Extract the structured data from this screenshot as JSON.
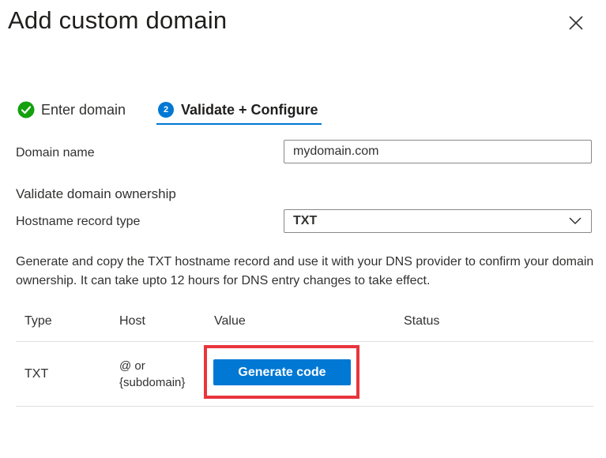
{
  "dialog": {
    "title": "Add custom domain",
    "close_icon": "close-icon"
  },
  "steps": [
    {
      "label": "Enter domain",
      "state": "completed",
      "icon": "check-circle-icon"
    },
    {
      "label": "Validate + Configure",
      "state": "active",
      "number": "2"
    }
  ],
  "form": {
    "domain_name_label": "Domain name",
    "domain_name_value": "mydomain.com",
    "section_heading": "Validate domain ownership",
    "record_type_label": "Hostname record type",
    "record_type_value": "TXT"
  },
  "description": "Generate and copy the TXT hostname record and use it with your DNS provider to confirm your domain ownership. It can take upto 12 hours for DNS entry changes to take effect.",
  "table": {
    "columns": [
      "Type",
      "Host",
      "Value",
      "Status"
    ],
    "rows": [
      {
        "type": "TXT",
        "host_line1": "@ or",
        "host_line2": "{subdomain}",
        "value_button": "Generate code",
        "status": ""
      }
    ]
  },
  "colors": {
    "accent": "#0078d4",
    "success": "#13a10e",
    "highlight": "#e8353d"
  }
}
